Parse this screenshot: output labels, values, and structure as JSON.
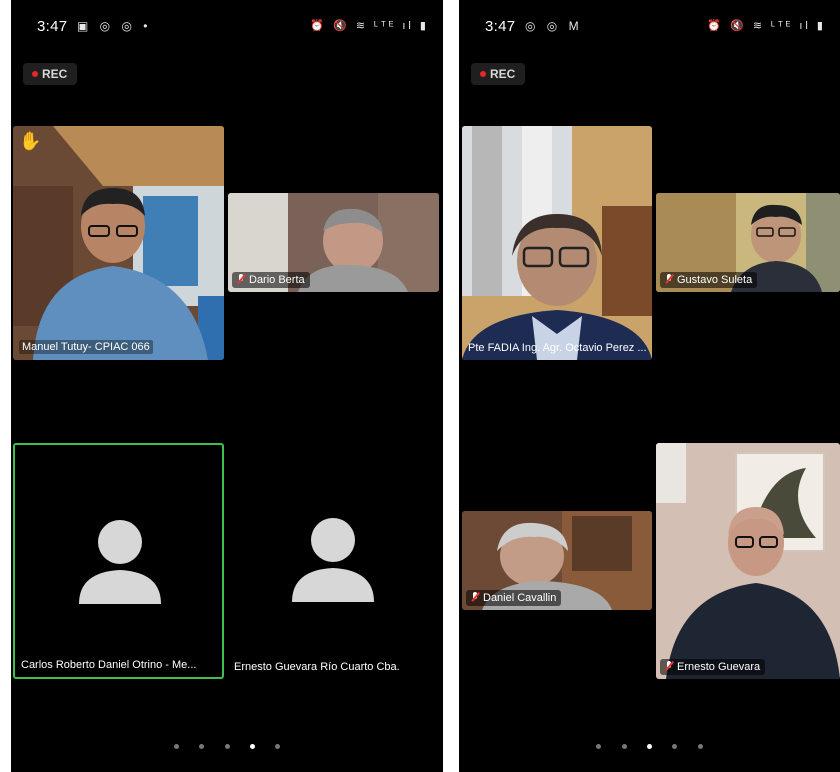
{
  "left_screen": {
    "status": {
      "time": "3:47",
      "icons": "▣ ◎ ◎ •",
      "right_icons": "⏰ 🔇 ≋ ᴸᵀᴱ ıl ▮"
    },
    "rec_label": "REC",
    "tiles": [
      {
        "name": "Manuel Tutuy- CPIAC 066",
        "kind": "video",
        "raised_hand": true
      },
      {
        "name": "Dario Berta",
        "kind": "video",
        "muted": true
      },
      {
        "name": "Carlos Roberto Daniel Otrino - Me...",
        "kind": "avatar",
        "active_speaker": true
      },
      {
        "name": "Ernesto Guevara Río Cuarto Cba.",
        "kind": "avatar"
      }
    ],
    "page_dots": {
      "total": 5,
      "active": 4
    }
  },
  "right_screen": {
    "status": {
      "time": "3:47",
      "icons": "◎ ◎ M",
      "right_icons": "⏰ 🔇 ≋ ᴸᵀᴱ ıl ▮"
    },
    "rec_label": "REC",
    "tiles": [
      {
        "name": "Pte FADIA Ing. Agr. Octavio Perez ...",
        "kind": "video"
      },
      {
        "name": "Gustavo Suleta",
        "kind": "video",
        "muted": true
      },
      {
        "name": "Daniel Cavallin",
        "kind": "video",
        "muted": true
      },
      {
        "name": "Ernesto Guevara",
        "kind": "video",
        "muted": true
      }
    ],
    "page_dots": {
      "total": 5,
      "active": 3
    }
  },
  "colors": {
    "active_border": "#3fbf4f",
    "rec_dot": "#e22a2a",
    "background": "#000000"
  }
}
